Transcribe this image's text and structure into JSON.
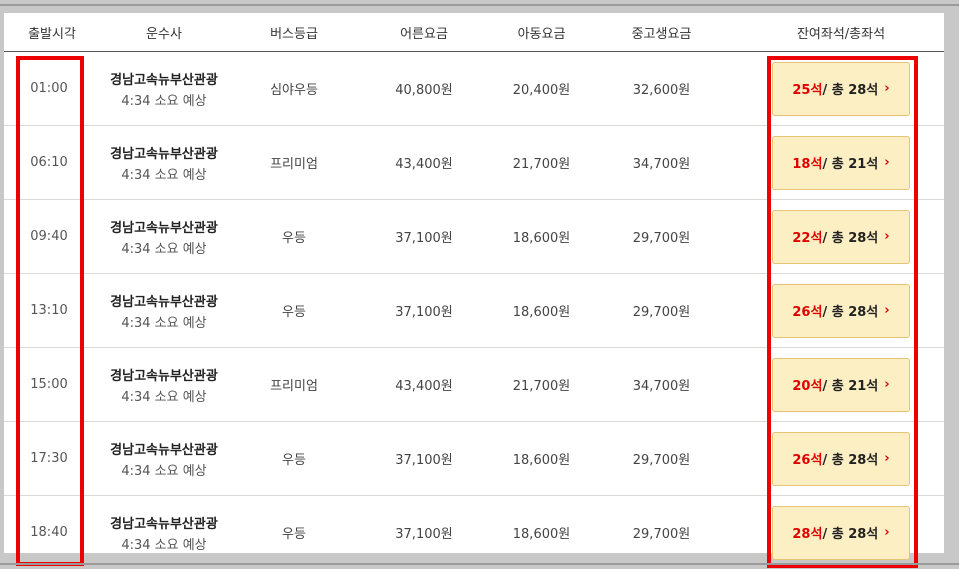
{
  "table": {
    "headers": [
      "출발시각",
      "운수사",
      "버스등급",
      "어른요금",
      "아동요금",
      "중고생요금",
      "잔여좌석/총좌석"
    ],
    "rows": [
      {
        "time": "01:00",
        "company": "경남고속뉴부산관광",
        "duration": "4:34 소요 예상",
        "grade": "심야우등",
        "adult": "40,800원",
        "child": "20,400원",
        "student": "32,600원",
        "remain": "25석",
        "total": " / 총 28석"
      },
      {
        "time": "06:10",
        "company": "경남고속뉴부산관광",
        "duration": "4:34 소요 예상",
        "grade": "프리미엄",
        "adult": "43,400원",
        "child": "21,700원",
        "student": "34,700원",
        "remain": "18석",
        "total": " / 총 21석"
      },
      {
        "time": "09:40",
        "company": "경남고속뉴부산관광",
        "duration": "4:34 소요 예상",
        "grade": "우등",
        "adult": "37,100원",
        "child": "18,600원",
        "student": "29,700원",
        "remain": "22석",
        "total": " / 총 28석"
      },
      {
        "time": "13:10",
        "company": "경남고속뉴부산관광",
        "duration": "4:34 소요 예상",
        "grade": "우등",
        "adult": "37,100원",
        "child": "18,600원",
        "student": "29,700원",
        "remain": "26석",
        "total": " / 총 28석"
      },
      {
        "time": "15:00",
        "company": "경남고속뉴부산관광",
        "duration": "4:34 소요 예상",
        "grade": "프리미엄",
        "adult": "43,400원",
        "child": "21,700원",
        "student": "34,700원",
        "remain": "20석",
        "total": " / 총 21석"
      },
      {
        "time": "17:30",
        "company": "경남고속뉴부산관광",
        "duration": "4:34 소요 예상",
        "grade": "우등",
        "adult": "37,100원",
        "child": "18,600원",
        "student": "29,700원",
        "remain": "26석",
        "total": " / 총 28석"
      },
      {
        "time": "18:40",
        "company": "경남고속뉴부산관광",
        "duration": "4:34 소요 예상",
        "grade": "우등",
        "adult": "37,100원",
        "child": "18,600원",
        "student": "29,700원",
        "remain": "28석",
        "total": " / 총 28석"
      }
    ]
  },
  "icons": {
    "seat_button_chevron": "chevron-right-icon"
  },
  "colors": {
    "remain_seats": "#e00000",
    "seat_button_bg": "#fdefc4",
    "highlight_box": "#ee0000"
  }
}
